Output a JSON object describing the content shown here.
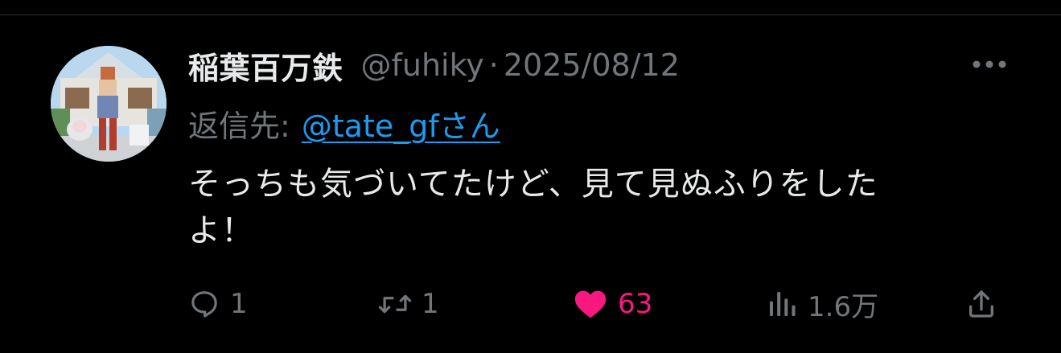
{
  "tweet": {
    "author": {
      "display_name": "稲葉百万鉄",
      "handle": "@fuhiky"
    },
    "separator": "·",
    "date": "2025/08/12",
    "reply_prefix": "返信先:",
    "reply_target": "@tate_gfさん",
    "text_line1": "そっちも気づいてたけど、見て見ぬふりをした",
    "text_line2": "よ！",
    "metrics": {
      "replies": "1",
      "retweets": "1",
      "likes": "63",
      "views": "1.6万"
    },
    "liked": true
  },
  "icons": {
    "more": "more-horizontal-icon",
    "reply": "reply-bubble-icon",
    "retweet": "retweet-icon",
    "like": "heart-icon",
    "views": "analytics-bars-icon",
    "share": "share-upload-icon"
  },
  "colors": {
    "background": "#000000",
    "primary_text": "#e7e9ea",
    "secondary_text": "#71767b",
    "link": "#1d9bf0",
    "like_pink": "#f91880",
    "divider": "#2f3336"
  }
}
